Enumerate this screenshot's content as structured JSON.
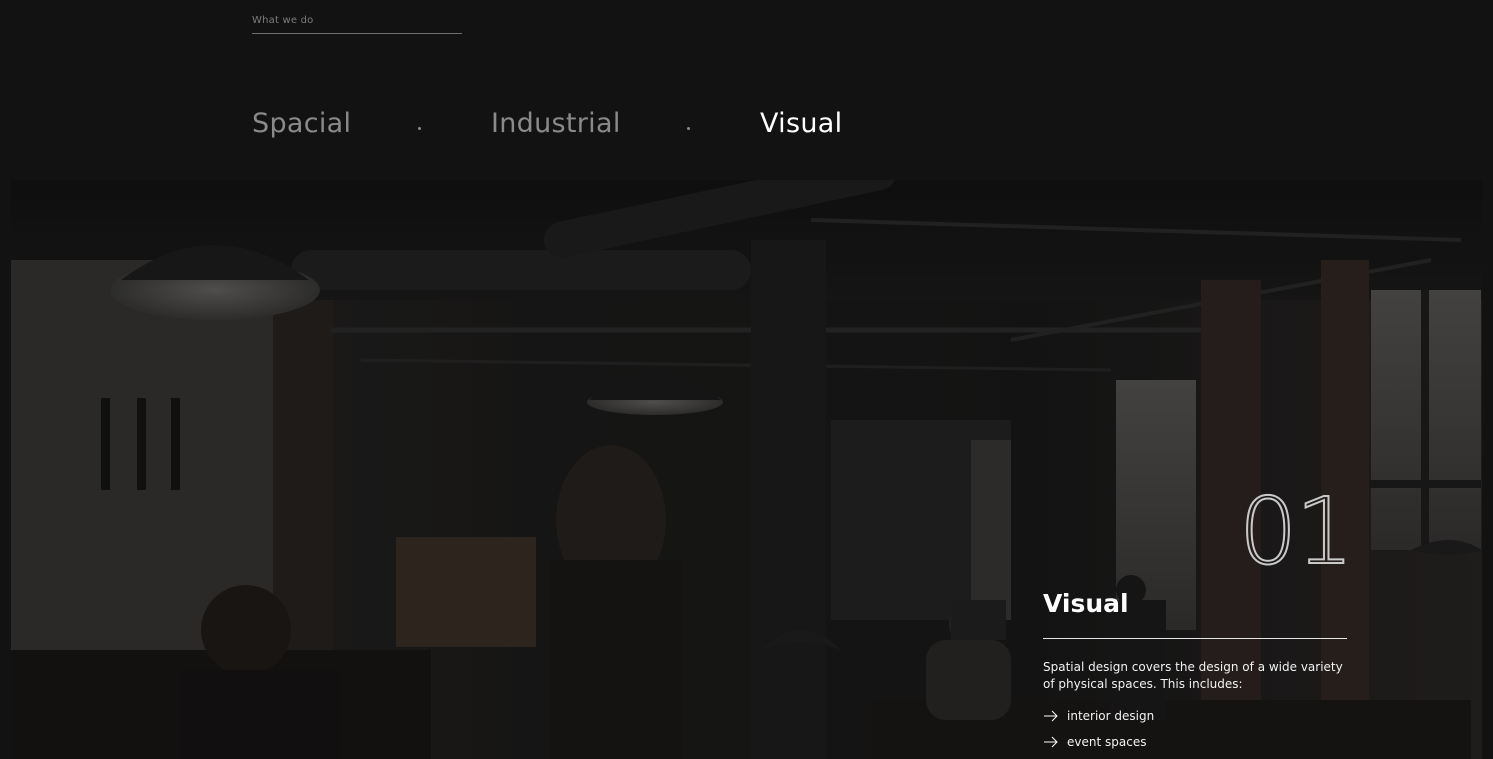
{
  "section": {
    "label": "What we do"
  },
  "tabs": [
    {
      "label": "Spacial",
      "active": false
    },
    {
      "label": "Industrial",
      "active": false
    },
    {
      "label": "Visual",
      "active": true
    }
  ],
  "hero": {
    "image_icon": "office-photo",
    "number": "01",
    "title": "Visual",
    "description": "Spatial design covers the design of a wide variety of physical spaces. This includes:",
    "items": [
      {
        "icon": "arrow-right-icon",
        "label": "interior design"
      },
      {
        "icon": "arrow-right-icon",
        "label": "event spaces"
      }
    ]
  },
  "colors": {
    "background": "#121212",
    "text": "#ffffff",
    "muted": "#8a8a8a"
  }
}
